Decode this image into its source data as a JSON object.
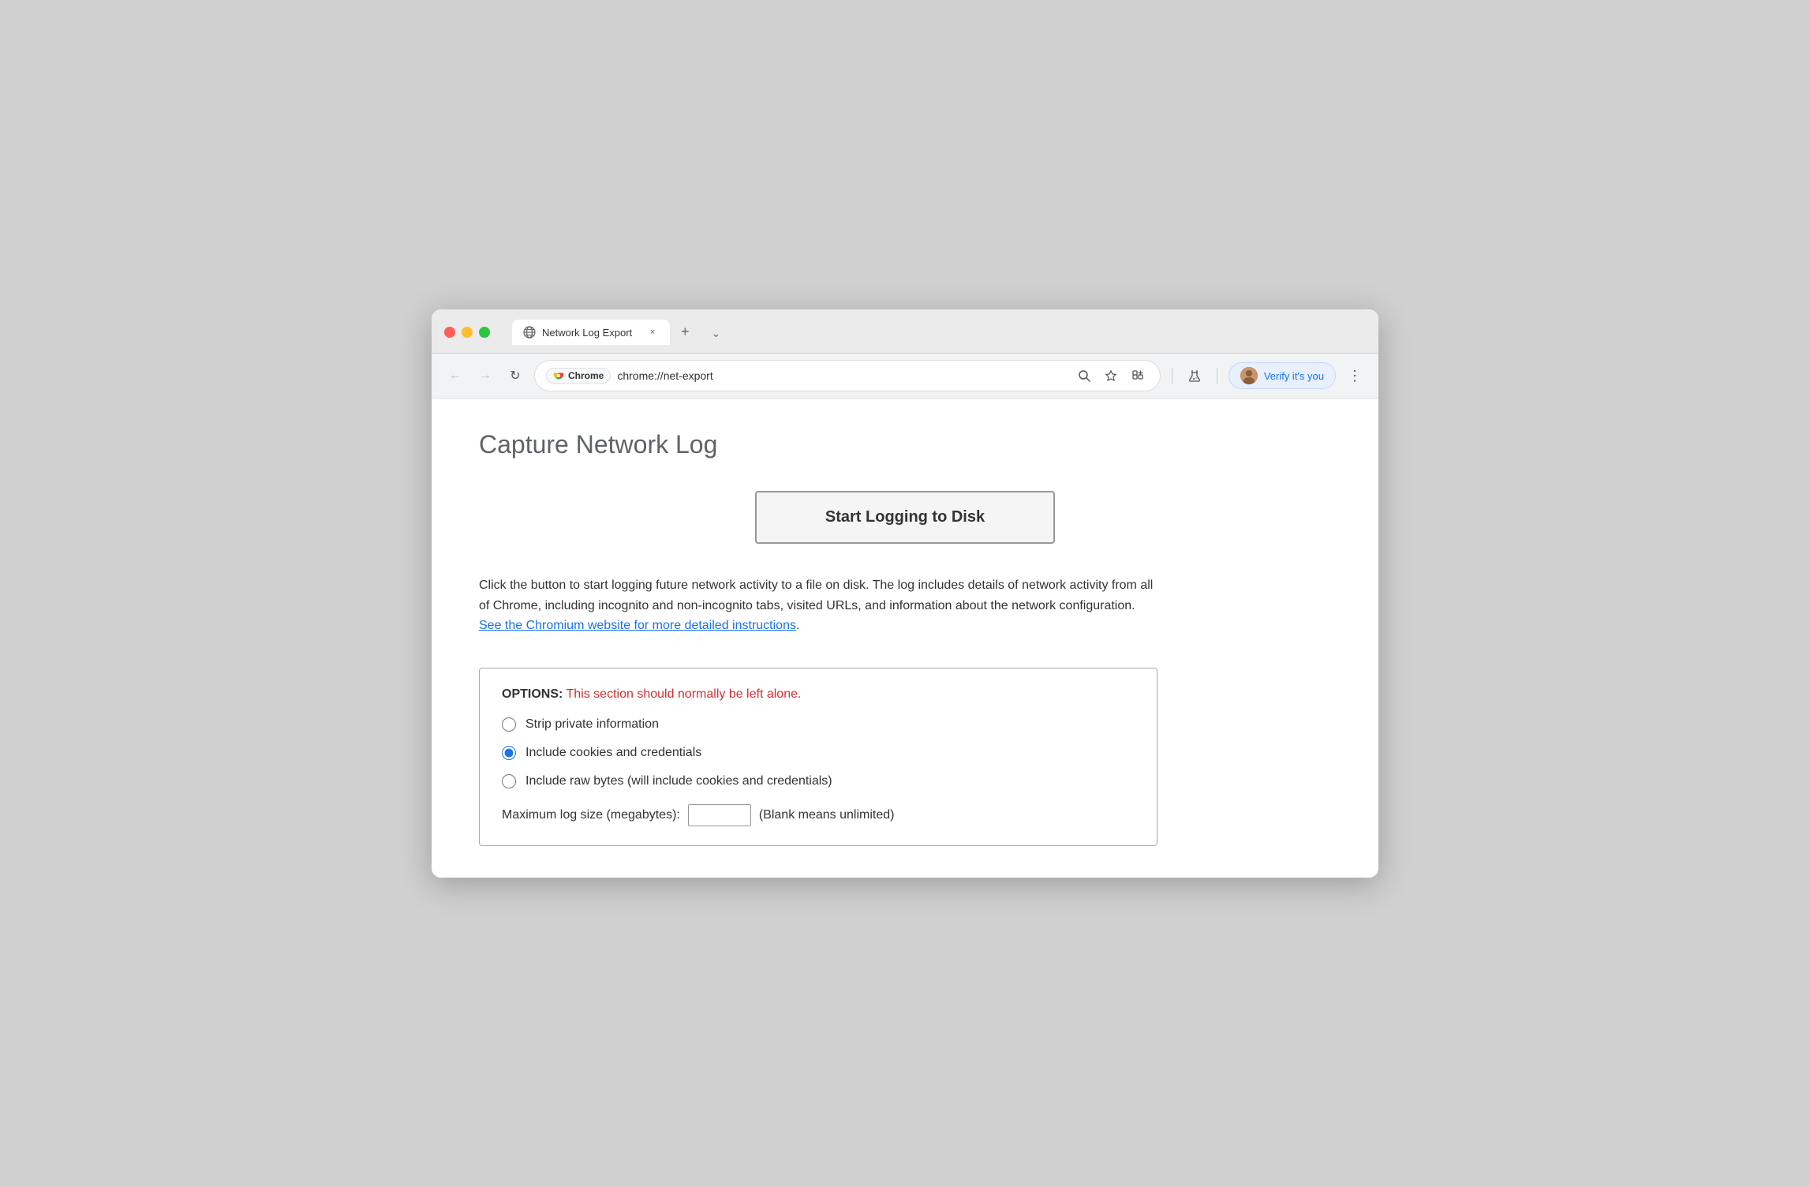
{
  "browser": {
    "tab": {
      "title": "Network Log Export",
      "close_label": "×",
      "new_tab_label": "+",
      "dropdown_label": "⌄"
    },
    "nav": {
      "back_label": "←",
      "forward_label": "→",
      "reload_label": "↻",
      "chrome_badge": "Chrome",
      "address": "chrome://net-export",
      "search_icon": "🔍",
      "bookmark_icon": "☆",
      "extensions_icon": "🧩",
      "lab_icon": "⚗",
      "verify_text": "Verify it's you",
      "more_icon": "⋮"
    }
  },
  "page": {
    "title": "Capture Network Log",
    "start_button_label": "Start Logging to Disk",
    "description": "Click the button to start logging future network activity to a file on disk. The log includes details of network activity from all of Chrome, including incognito and non-incognito tabs, visited URLs, and information about the network configuration.",
    "description_link_text": "See the Chromium website for more detailed instructions",
    "description_end": ".",
    "options": {
      "header_bold": "OPTIONS:",
      "header_warning": " This section should normally be left alone.",
      "radio_items": [
        {
          "id": "strip",
          "label": "Strip private information",
          "checked": false
        },
        {
          "id": "cookies",
          "label": "Include cookies and credentials",
          "checked": true
        },
        {
          "id": "raw",
          "label": "Include raw bytes (will include cookies and credentials)",
          "checked": false
        }
      ],
      "max_log_label": "Maximum log size (megabytes):",
      "max_log_value": "",
      "max_log_note": "(Blank means unlimited)"
    }
  }
}
